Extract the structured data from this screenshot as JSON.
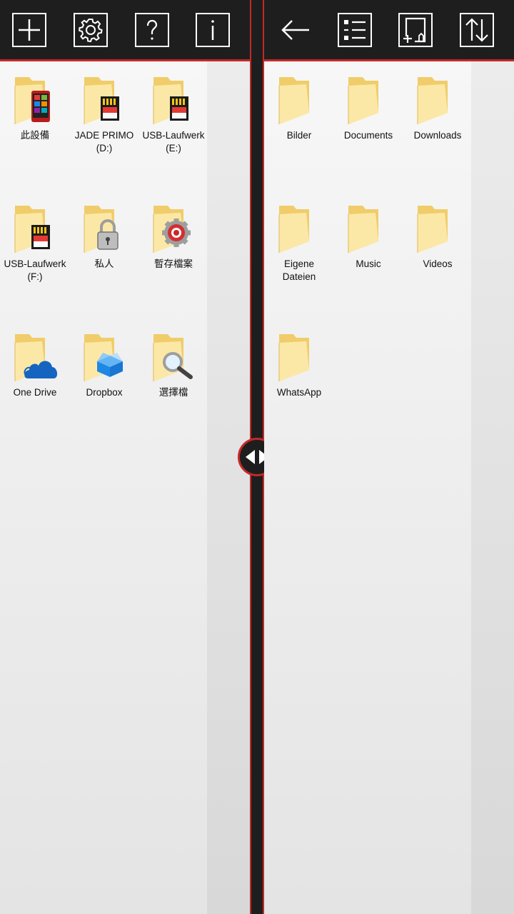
{
  "left_toolbar": {
    "buttons": [
      {
        "name": "add-button",
        "icon": "plus-icon"
      },
      {
        "name": "settings-button",
        "icon": "gear-icon"
      },
      {
        "name": "help-button",
        "icon": "question-icon"
      },
      {
        "name": "info-button",
        "icon": "info-icon"
      }
    ]
  },
  "right_toolbar": {
    "buttons": [
      {
        "name": "back-button",
        "icon": "arrow-left-icon"
      },
      {
        "name": "list-view-button",
        "icon": "list-icon"
      },
      {
        "name": "new-file-button",
        "icon": "new-document-icon"
      },
      {
        "name": "sort-button",
        "icon": "sort-arrows-icon"
      }
    ]
  },
  "left_pane": {
    "items": [
      {
        "label": "此設備",
        "badge": "phone-icon"
      },
      {
        "label": "JADE PRIMO\n(D:)",
        "badge": "sd-card-icon"
      },
      {
        "label": "USB-Laufwerk\n(E:)",
        "badge": "sd-card-icon"
      },
      {
        "label": "USB-Laufwerk\n(F:)",
        "badge": "sd-card-icon"
      },
      {
        "label": "私人",
        "badge": "padlock-icon"
      },
      {
        "label": "暫存檔案",
        "badge": "gear-badge-icon"
      },
      {
        "label": "One Drive",
        "badge": "cloud-icon"
      },
      {
        "label": "Dropbox",
        "badge": "box-icon"
      },
      {
        "label": "選擇檔",
        "badge": "magnifier-icon"
      }
    ]
  },
  "right_pane": {
    "items": [
      {
        "label": "Bilder"
      },
      {
        "label": "Documents"
      },
      {
        "label": "Downloads"
      },
      {
        "label": "Eigene\nDateien"
      },
      {
        "label": "Music"
      },
      {
        "label": "Videos"
      },
      {
        "label": "WhatsApp"
      }
    ]
  },
  "colors": {
    "toolbar_bg": "#1e1e1e",
    "accent": "#c62828",
    "folder_light": "#fce8a6",
    "folder_dark": "#f0cd6a"
  }
}
